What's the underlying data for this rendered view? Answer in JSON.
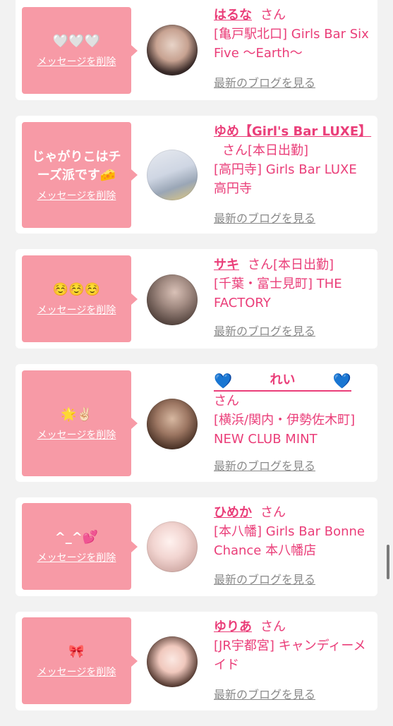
{
  "cards": [
    {
      "message": "🤍🤍🤍",
      "delete_label": "メッセージを削除",
      "name": "はるな",
      "san": "さん",
      "badge": "",
      "shop": "[亀戸駅北口] Girls Bar Six Five 〜Earth〜",
      "blog_label": "最新のブログを見る"
    },
    {
      "message": "じゃがりこはチーズ派です🧀",
      "delete_label": "メッセージを削除",
      "name": "ゆめ【Girl's Bar LUXE】",
      "san": "さん",
      "badge": "[本日出勤]",
      "shop": "[高円寺] Girls Bar LUXE 高円寺",
      "blog_label": "最新のブログを見る"
    },
    {
      "message": "☺️☺️☺️",
      "delete_label": "メッセージを削除",
      "name": "サキ",
      "san": "さん",
      "badge": "[本日出勤]",
      "shop": "[千葉・富士見町] THE FACTORY",
      "blog_label": "最新のブログを見る"
    },
    {
      "message": "🌟✌🏻",
      "delete_label": "メッセージを削除",
      "name": "れい",
      "name_prefix": "💙",
      "name_suffix": "💙",
      "san": "さん",
      "badge": "",
      "shop": "[横浜/関内・伊勢佐木町] NEW CLUB MINT",
      "blog_label": "最新のブログを見る"
    },
    {
      "message": "^_^💕",
      "delete_label": "メッセージを削除",
      "name": "ひめか",
      "san": "さん",
      "badge": "",
      "shop": "[本八幡] Girls Bar Bonne Chance 本八幡店",
      "blog_label": "最新のブログを見る"
    },
    {
      "message": "🎀",
      "delete_label": "メッセージを削除",
      "name": "ゆりあ",
      "san": "さん",
      "badge": "",
      "shop": "[JR宇都宮] キャンディーメイド",
      "blog_label": "最新のブログを見る"
    }
  ],
  "colors": {
    "bubble": "#f79aa6",
    "accent": "#ea3e79",
    "blog_link": "#8a8a8a",
    "background": "#f2f2f2"
  }
}
